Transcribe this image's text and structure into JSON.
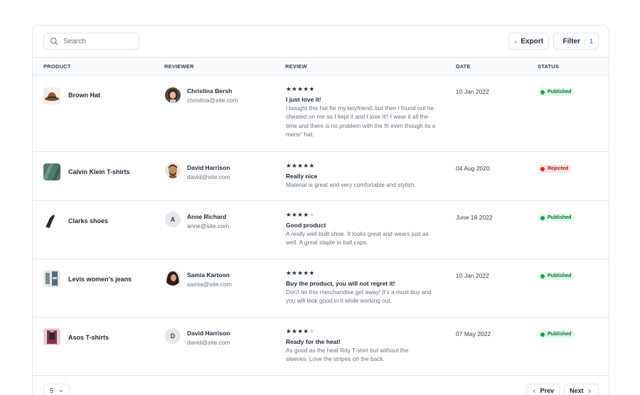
{
  "toolbar": {
    "search_placeholder": "Search",
    "export_label": "Export",
    "filter_label": "Filter",
    "filter_count": "1"
  },
  "columns": {
    "product": "PRODUCT",
    "reviewer": "REVIEWER",
    "review": "REVIEW",
    "date": "DATE",
    "status": "STATUS"
  },
  "rows": [
    {
      "product": "Brown Hat",
      "reviewer_name": "Christina Bersh",
      "reviewer_email": "christina@site.com",
      "rating": 5,
      "stars": "★★★★★",
      "stars_off": "",
      "review_title": "I just love it!",
      "review_text": "I bought this hat for my boyfriend, but then i found out he cheated on me so I kept it and I love it!! I wear it all the time and there is no problem with the fit even though its a mens\" hat.",
      "date": "10 Jan 2022",
      "status": "Published"
    },
    {
      "product": "Calvin Klein T-shirts",
      "reviewer_name": "David Harrison",
      "reviewer_email": "david@site.com",
      "rating": 5,
      "stars": "★★★★★",
      "stars_off": "",
      "review_title": "Really nice",
      "review_text": "Material is great and very comfortable and stylish.",
      "date": "04 Aug 2020",
      "status": "Rejected"
    },
    {
      "product": "Clarks shoes",
      "reviewer_name": "Anne Richard",
      "reviewer_email": "anne@site.com",
      "reviewer_initial": "A",
      "rating": 4,
      "stars": "★★★★",
      "stars_off": "★",
      "review_title": "Good product",
      "review_text": "A really well built shoe. It looks great and wears just as well. A great staple in ball caps.",
      "date": "June 18 2022",
      "status": "Published"
    },
    {
      "product": "Levis women's jeans",
      "reviewer_name": "Samia Kartoon",
      "reviewer_email": "samia@site.com",
      "rating": 5,
      "stars": "★★★★★",
      "stars_off": "",
      "review_title": "Buy the product, you will not regret it!",
      "review_text": "Don't let this merchandise get away! It's a must buy and you will look good in it while working out.",
      "date": "10 Jan 2022",
      "status": "Published"
    },
    {
      "product": "Asos T-shirts",
      "reviewer_name": "David Harrison",
      "reviewer_email": "david@site.com",
      "reviewer_initial": "D",
      "rating": 4,
      "stars": "★★★★",
      "stars_off": "★",
      "review_title": "Ready for the heat!",
      "review_text": "As good as the heat Rdy T-shirt but without the sleeves. Love the stripes on the back.",
      "date": "07 May 2022",
      "status": "Published"
    }
  ],
  "footer": {
    "per_page": "5",
    "prev_label": "Prev",
    "next_label": "Next"
  },
  "colors": {
    "published_bg": "#dcfce7",
    "published_text": "#166534",
    "rejected_bg": "#fee2e2",
    "rejected_text": "#991b1b",
    "accent": "#2563eb"
  },
  "icons": {
    "search": "search-icon",
    "export": "download-icon",
    "filter": "filter-icon",
    "chevron_down": "chevron-down-icon",
    "chevron_left": "chevron-left-icon",
    "chevron_right": "chevron-right-icon",
    "status_check": "check-circle-icon",
    "status_reject": "x-circle-icon"
  }
}
